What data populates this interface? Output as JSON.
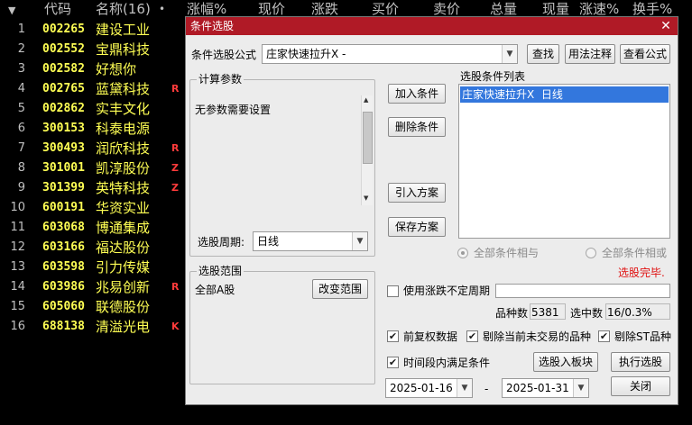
{
  "list_header": {
    "arrow": "▼",
    "code": "代码",
    "name": "名称(16)",
    "dot": "•",
    "change_pct": "涨幅%",
    "price": "现价",
    "change": "涨跌",
    "bid": "买价",
    "ask": "卖价",
    "volume": "总量",
    "cur_volume": "现量",
    "speed": "涨速%",
    "turnover": "换手%"
  },
  "stocks": [
    {
      "idx": "1",
      "code": "002265",
      "name": "建设工业",
      "mark": ""
    },
    {
      "idx": "2",
      "code": "002552",
      "name": "宝鼎科技",
      "mark": ""
    },
    {
      "idx": "3",
      "code": "002582",
      "name": "好想你",
      "mark": ""
    },
    {
      "idx": "4",
      "code": "002765",
      "name": "蓝黛科技",
      "mark": "R"
    },
    {
      "idx": "5",
      "code": "002862",
      "name": "实丰文化",
      "mark": ""
    },
    {
      "idx": "6",
      "code": "300153",
      "name": "科泰电源",
      "mark": ""
    },
    {
      "idx": "7",
      "code": "300493",
      "name": "润欣科技",
      "mark": "R"
    },
    {
      "idx": "8",
      "code": "301001",
      "name": "凯淳股份",
      "mark": "Z"
    },
    {
      "idx": "9",
      "code": "301399",
      "name": "英特科技",
      "mark": "Z"
    },
    {
      "idx": "10",
      "code": "600191",
      "name": "华资实业",
      "mark": ""
    },
    {
      "idx": "11",
      "code": "603068",
      "name": "博通集成",
      "mark": ""
    },
    {
      "idx": "12",
      "code": "603166",
      "name": "福达股份",
      "mark": ""
    },
    {
      "idx": "13",
      "code": "603598",
      "name": "引力传媒",
      "mark": ""
    },
    {
      "idx": "14",
      "code": "603986",
      "name": "兆易创新",
      "mark": "R"
    },
    {
      "idx": "15",
      "code": "605060",
      "name": "联德股份",
      "mark": ""
    },
    {
      "idx": "16",
      "code": "688138",
      "name": "清溢光电",
      "mark": "K"
    }
  ],
  "dialog": {
    "title": "条件选股",
    "close": "✕",
    "formula_label": "条件选股公式",
    "formula_value": "庄家快速拉升X -",
    "find_btn": "查找",
    "usage_btn": "用法注释",
    "view_formula_btn": "查看公式",
    "params_group": "计算参数",
    "params_text": "无参数需要设置",
    "period_label": "选股周期:",
    "period_value": "日线",
    "add_btn": "加入条件",
    "delete_btn": "删除条件",
    "import_btn": "引入方案",
    "save_btn": "保存方案",
    "cond_list_label": "选股条件列表",
    "cond_items": [
      "庄家快速拉升X  日线"
    ],
    "radio_and": "全部条件相与",
    "radio_or": "全部条件相或",
    "status": "选股完毕.",
    "range_group": "选股范围",
    "range_value": "全部A股",
    "change_range_btn": "改变范围",
    "use_uncertain": "使用涨跌不定周期",
    "count_label": "品种数",
    "count_value": "5381",
    "selected_label": "选中数",
    "selected_value": "16/0.3%",
    "forward_adj": "前复权数据",
    "exclude_untraded": "剔除当前未交易的品种",
    "exclude_st": "剔除ST品种",
    "time_range": "时间段内满足条件",
    "to_block_btn": "选股入板块",
    "execute_btn": "执行选股",
    "date_from": "2025-01-16",
    "date_sep": "-",
    "date_to": "2025-01-31",
    "close_btn": "关闭"
  }
}
